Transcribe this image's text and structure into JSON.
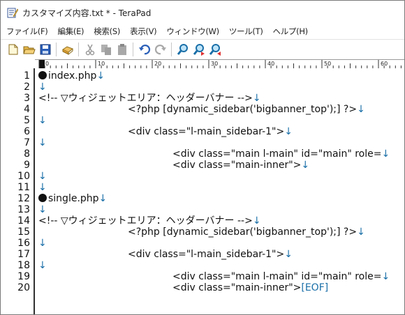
{
  "window": {
    "title": "カスタマイズ内容.txt * - TeraPad"
  },
  "menu": [
    "ファイル(F)",
    "編集(E)",
    "検索(S)",
    "表示(V)",
    "ウィンドウ(W)",
    "ツール(T)",
    "ヘルプ(H)"
  ],
  "toolbar": {
    "icons": [
      "new-file-icon",
      "open-folder-icon",
      "save-icon",
      "print-icon",
      "cut-icon",
      "copy-icon",
      "paste-icon",
      "undo-icon",
      "redo-icon",
      "search-icon",
      "search-next-icon",
      "search-prev-icon"
    ]
  },
  "ruler": {
    "labels": [
      "0",
      "10",
      "20",
      "30",
      "40",
      "50",
      "60"
    ]
  },
  "colors": {
    "newline_marker": "#1a6fa8",
    "text": "#111111"
  },
  "editor": {
    "newline_mark": "↓",
    "eof_mark": "[EOF]",
    "lines": [
      {
        "num": "1",
        "text": "index.php",
        "bullet": true
      },
      {
        "num": "2",
        "text": ""
      },
      {
        "num": "3",
        "text": "<!-- ▽ウィジェットエリア：ヘッダーバナー -->"
      },
      {
        "num": "4",
        "text": "\t\t<?php [dynamic_sidebar('bigbanner_top');] ?>"
      },
      {
        "num": "5",
        "text": ""
      },
      {
        "num": "6",
        "text": "\t\t<div class=\"l-main_sidebar-1\">"
      },
      {
        "num": "7",
        "text": ""
      },
      {
        "num": "8",
        "text": "\t\t\t<div class=\"main l-main\" id=\"main\" role="
      },
      {
        "num": "9",
        "text": "\t\t\t<div class=\"main-inner\">"
      },
      {
        "num": "10",
        "text": ""
      },
      {
        "num": "11",
        "text": ""
      },
      {
        "num": "12",
        "text": "single.php",
        "bullet": true
      },
      {
        "num": "13",
        "text": ""
      },
      {
        "num": "14",
        "text": "<!-- ▽ウィジェットエリア：ヘッダーバナー -->"
      },
      {
        "num": "15",
        "text": "\t\t<?php [dynamic_sidebar('bigbanner_top');] ?>"
      },
      {
        "num": "16",
        "text": ""
      },
      {
        "num": "17",
        "text": "\t\t<div class=\"l-main_sidebar-1\">"
      },
      {
        "num": "18",
        "text": ""
      },
      {
        "num": "19",
        "text": "\t\t\t<div class=\"main l-main\" id=\"main\" role="
      },
      {
        "num": "20",
        "text": "\t\t\t<div class=\"main-inner\">",
        "eof": true
      }
    ]
  }
}
